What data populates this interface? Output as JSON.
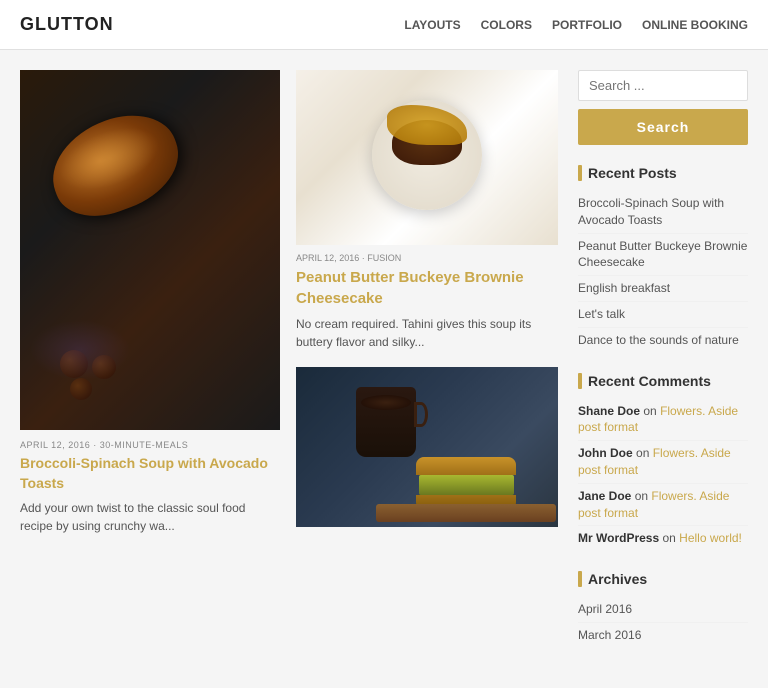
{
  "header": {
    "logo": "GLUTTON",
    "nav": [
      "LAYOUTS",
      "COLORS",
      "PORTFOLIO",
      "ONLINE BOOKING"
    ]
  },
  "left_post": {
    "meta": "APRIL 12, 2016 · 30-MINUTE-MEALS",
    "title": "Broccoli-Spinach Soup with Avocado Toasts",
    "excerpt": "Add your own twist to the classic soul food recipe by using crunchy wa..."
  },
  "top_right_post": {
    "meta": "APRIL 12, 2016 · FUSION",
    "title": "Peanut Butter Buckeye Brownie Cheesecake",
    "excerpt": "No cream required. Tahini gives this soup its buttery flavor and silky..."
  },
  "sidebar": {
    "search_placeholder": "Search ...",
    "search_button_label": "Search",
    "recent_posts_title": "Recent Posts",
    "recent_posts": [
      "Broccoli-Spinach Soup with Avocado Toasts",
      "Peanut Butter Buckeye Brownie Cheesecake",
      "English breakfast",
      "Let's talk",
      "Dance to the sounds of nature"
    ],
    "recent_comments_title": "Recent Comments",
    "recent_comments": [
      {
        "author": "Shane Doe",
        "action": "on",
        "link": "Flowers. Aside post format"
      },
      {
        "author": "John Doe",
        "action": "on",
        "link": "Flowers. Aside post format"
      },
      {
        "author": "Jane Doe",
        "action": "on",
        "link": "Flowers. Aside post format"
      },
      {
        "author": "Mr WordPress",
        "action": "on",
        "link": "Hello world!"
      }
    ],
    "archives_title": "Archives",
    "archives": [
      "April 2016",
      "March 2016"
    ]
  }
}
